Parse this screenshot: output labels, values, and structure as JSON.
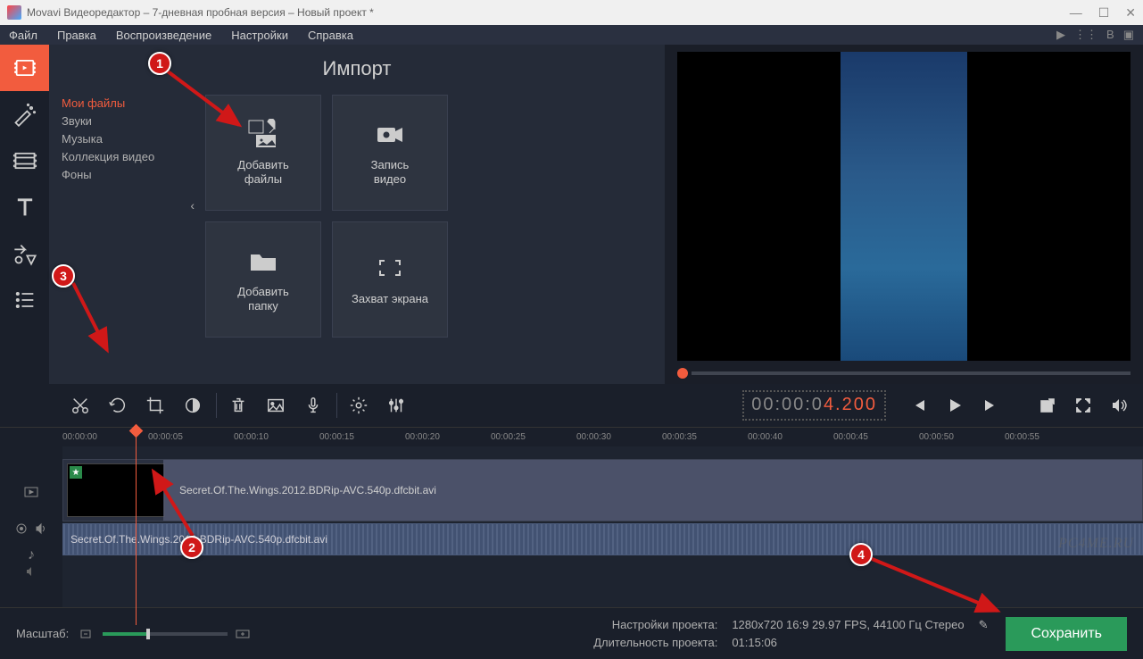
{
  "titlebar": {
    "title": "Movavi Видеоредактор – 7-дневная пробная версия – Новый проект *"
  },
  "menu": {
    "items": [
      "Файл",
      "Правка",
      "Воспроизведение",
      "Настройки",
      "Справка"
    ]
  },
  "left_tabs": [
    "import",
    "wand",
    "filters",
    "text",
    "shapes",
    "list"
  ],
  "import": {
    "title": "Импорт",
    "sidebar": {
      "items": [
        "Мои файлы",
        "Звуки",
        "Музыка",
        "Коллекция видео",
        "Фоны"
      ],
      "active": 0
    },
    "tiles": [
      {
        "label": "Добавить\nфайлы",
        "name": "add-files-tile"
      },
      {
        "label": "Запись\nвидео",
        "name": "record-video-tile"
      },
      {
        "label": "Добавить\nпапку",
        "name": "add-folder-tile"
      },
      {
        "label": "Захват экрана",
        "name": "screen-capture-tile"
      }
    ]
  },
  "timecode": {
    "gray": "00:00:0",
    "hi": "4.200"
  },
  "ruler": [
    "00:00:00",
    "00:00:05",
    "00:00:10",
    "00:00:15",
    "00:00:20",
    "00:00:25",
    "00:00:30",
    "00:00:35",
    "00:00:40",
    "00:00:45",
    "00:00:50",
    "00:00:55"
  ],
  "timeline": {
    "video_clip": "Secret.Of.The.Wings.2012.BDRip-AVC.540p.dfcbit.avi",
    "audio_clip": "Secret.Of.The.Wings.2012.BDRip-AVC.540p.dfcbit.avi"
  },
  "bottom": {
    "scale_label": "Масштаб:",
    "project_settings_label": "Настройки проекта:",
    "project_settings_value": "1280x720 16:9 29.97 FPS, 44100 Гц Стерео",
    "duration_label": "Длительность проекта:",
    "duration_value": "01:15:06",
    "save_label": "Сохранить"
  },
  "annotations": {
    "a1": "1",
    "a2": "2",
    "a3": "3",
    "a4": "4"
  },
  "watermark": "PC4ME.RU"
}
